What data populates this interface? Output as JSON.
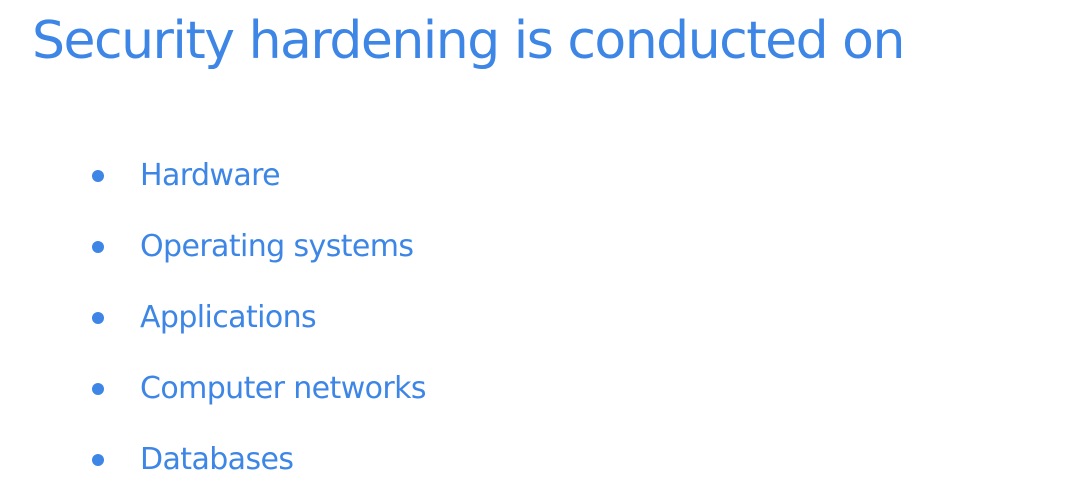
{
  "slide": {
    "title": "Security hardening is conducted on",
    "items": [
      {
        "label": "Hardware"
      },
      {
        "label": "Operating systems"
      },
      {
        "label": "Applications"
      },
      {
        "label": "Computer networks"
      },
      {
        "label": "Databases"
      }
    ]
  },
  "colors": {
    "text": "#3d86e6",
    "background": "#ffffff"
  }
}
